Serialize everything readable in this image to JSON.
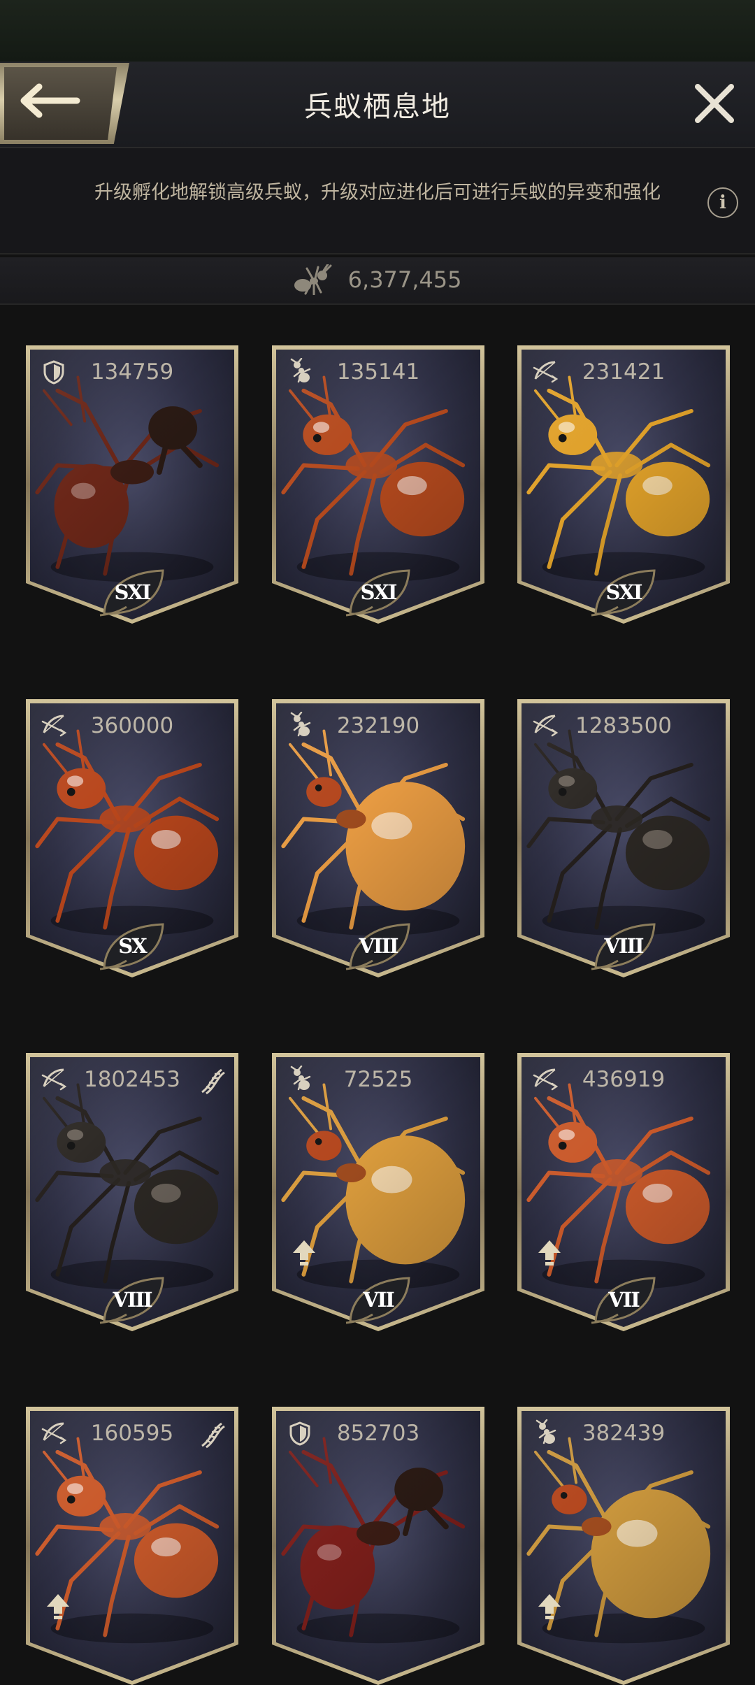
{
  "header": {
    "title": "兵蚁栖息地"
  },
  "info": {
    "text": "升级孵化地解锁高级兵蚁，升级对应进化后可进行兵蚁的异变和强化"
  },
  "resource": {
    "ant_count": "6,377,455"
  },
  "colors": {
    "gold": "#d2c49b",
    "card_bg": "#2e2f44",
    "text": "#bdb6a8"
  },
  "cards": [
    {
      "type_icon": "shield-icon",
      "power": "134759",
      "tier": "SXI",
      "ant_color": "#6a2618",
      "ant_style": "soldier"
    },
    {
      "type_icon": "ant-icon",
      "power": "135141",
      "tier": "SXI",
      "ant_color": "#b54a1e",
      "ant_style": "slim"
    },
    {
      "type_icon": "bow-icon",
      "power": "231421",
      "tier": "SXI",
      "ant_color": "#e0a12a",
      "ant_style": "slim"
    },
    {
      "type_icon": "bow-icon",
      "power": "360000",
      "tier": "SX",
      "ant_color": "#b8461c",
      "ant_style": "slim"
    },
    {
      "type_icon": "ant-icon",
      "power": "232190",
      "tier": "VIII",
      "ant_color": "#e69a42",
      "ant_style": "honeypot"
    },
    {
      "type_icon": "bow-icon",
      "power": "1283500",
      "tier": "VIII",
      "ant_color": "#2c2824",
      "ant_style": "black"
    },
    {
      "type_icon": "bow-icon",
      "power": "1802453",
      "tier": "VIII",
      "dna": true,
      "ant_color": "#2c2824",
      "ant_style": "black"
    },
    {
      "type_icon": "ant-icon",
      "power": "72525",
      "tier": "VII",
      "upgrade": true,
      "ant_color": "#d89a3c",
      "ant_style": "honeypot"
    },
    {
      "type_icon": "bow-icon",
      "power": "436919",
      "tier": "VII",
      "upgrade": true,
      "ant_color": "#c9592a",
      "ant_style": "slim"
    },
    {
      "type_icon": "bow-icon",
      "power": "160595",
      "dna": true,
      "upgrade": true,
      "ant_color": "#c9592a",
      "ant_style": "slim"
    },
    {
      "type_icon": "shield-icon",
      "power": "852703",
      "ant_color": "#7a1e1a",
      "ant_style": "soldier"
    },
    {
      "type_icon": "ant-icon",
      "power": "382439",
      "upgrade": true,
      "ant_color": "#c8953c",
      "ant_style": "honeypot"
    }
  ]
}
